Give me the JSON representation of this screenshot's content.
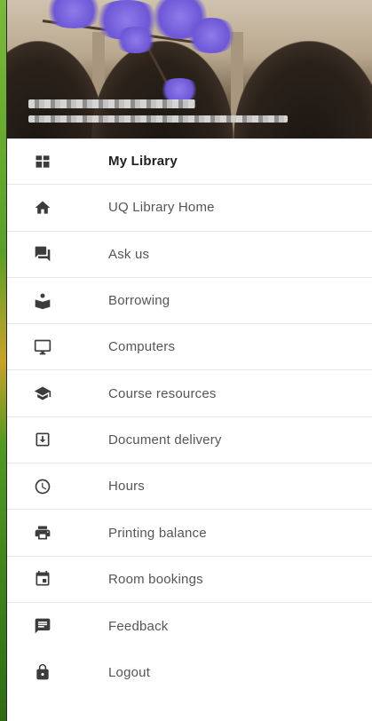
{
  "menu": {
    "items": [
      {
        "label": "My Library",
        "icon": "dashboard-icon",
        "active": true
      },
      {
        "label": "UQ Library Home",
        "icon": "home-icon"
      },
      {
        "label": "Ask us",
        "icon": "chat-icon"
      },
      {
        "label": "Borrowing",
        "icon": "book-reader-icon"
      },
      {
        "label": "Computers",
        "icon": "monitor-icon"
      },
      {
        "label": "Course resources",
        "icon": "graduation-cap-icon"
      },
      {
        "label": "Document delivery",
        "icon": "download-box-icon"
      },
      {
        "label": "Hours",
        "icon": "clock-icon"
      },
      {
        "label": "Printing balance",
        "icon": "printer-icon"
      },
      {
        "label": "Room bookings",
        "icon": "calendar-icon"
      },
      {
        "label": "Feedback",
        "icon": "feedback-icon"
      },
      {
        "label": "Logout",
        "icon": "lock-icon"
      }
    ]
  },
  "colors": {
    "active_text": "#212121",
    "text": "#555555",
    "icon": "#3c3c3c",
    "divider": "#e6e6e6",
    "background_green": "#3a7d1e"
  }
}
